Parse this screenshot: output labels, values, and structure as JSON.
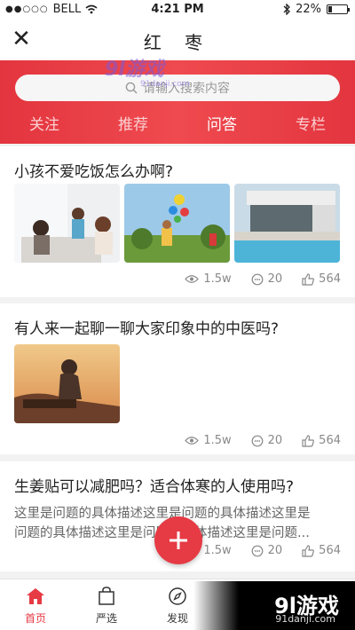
{
  "status_bar": {
    "carrier": "BELL",
    "time": "4:21 PM",
    "battery": "22%"
  },
  "nav": {
    "title": "红 枣"
  },
  "search": {
    "placeholder": "请输入搜索内容"
  },
  "tabs": [
    {
      "label": "关注"
    },
    {
      "label": "推荐"
    },
    {
      "label": "问答"
    },
    {
      "label": "专栏"
    }
  ],
  "active_tab": "问答",
  "posts": [
    {
      "question": "小孩不爱吃饭怎么办啊?",
      "views": "1.5w",
      "comments": "20",
      "likes": "564"
    },
    {
      "question": "有人来一起聊一聊大家印象中的中医吗?",
      "views": "1.5w",
      "comments": "20",
      "likes": "564"
    },
    {
      "question": "生姜贴可以减肥吗？适合体寒的人使用吗?",
      "desc_lines": [
        "这里是问题的具体描述这里是问题的具体描述这里是",
        "问题的具体描述这里是问题的具体描述这里是问题..."
      ],
      "views": "1.5w",
      "comments": "20",
      "likes": "564"
    }
  ],
  "tabbar": [
    {
      "label": "首页",
      "icon": "home-icon"
    },
    {
      "label": "严选",
      "icon": "shopping-bag-icon"
    },
    {
      "label": "发现",
      "icon": "compass-icon"
    }
  ],
  "watermark": {
    "brand": "9l游戏",
    "url": "91danji.com"
  },
  "logo_watermark": {
    "brand": "9l游戏",
    "url": "91danji.com"
  },
  "colors": {
    "accent": "#e63a44",
    "header": "#ef4a4f"
  }
}
